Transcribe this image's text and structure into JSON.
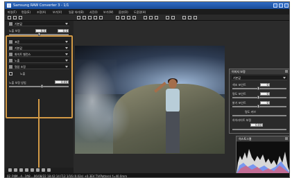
{
  "window": {
    "title": "Samsung RAW Converter 3 - 1/1"
  },
  "menu": [
    "파일(F)",
    "편집(E)",
    "조정(A)",
    "보기(V)",
    "일괄 처리(B)",
    "사진(I)",
    "보기(W)",
    "옵션(O)",
    "도움말(H)"
  ],
  "left_panel": {
    "preset_label": "기본값",
    "exposure_label": "노출 보정",
    "exposure_value": "0.0",
    "exposure_value2": "0.0",
    "rows": [
      "표준",
      "기본값",
      "화이트 밸런스",
      "노출",
      "명암 조정"
    ],
    "noise_label": "노출 보정 방법",
    "noise_value": "0.00",
    "option_label": "노출"
  },
  "adjust_panel": {
    "title": "이미지 보정",
    "preset": "기본값",
    "labels": [
      "색조 포인트",
      "명도 포인트",
      "밝기 포인트",
      "명도 커브",
      "하이라이트 보정"
    ],
    "values": [
      "0",
      "0",
      "0",
      "0",
      "0.00"
    ]
  },
  "histogram_panel": {
    "title": "히스토그램"
  },
  "status": {
    "text": "02_P4M...4...1ft8 ...06/08/22 18:42:14 F12  1/16 (0.02s)  +0.3EV  TV(Pattern) f=40.0mm"
  }
}
